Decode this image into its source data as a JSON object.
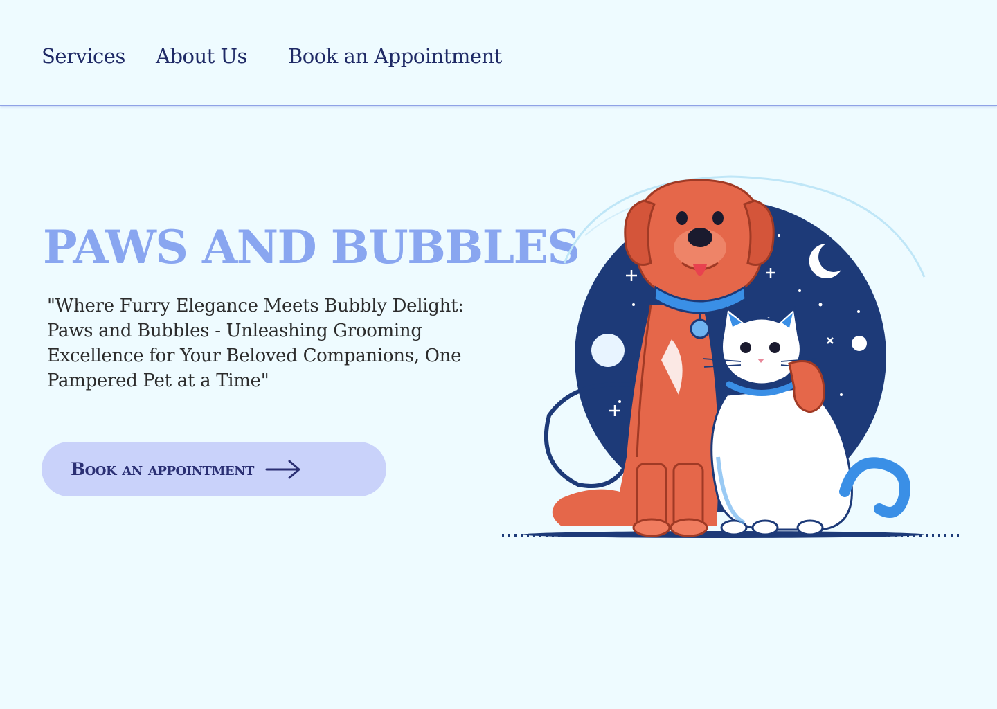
{
  "nav": {
    "items": [
      {
        "label": "Services"
      },
      {
        "label": "About Us"
      },
      {
        "label": "Book an Appointment"
      }
    ]
  },
  "hero": {
    "title": "PAWS AND BUBBLES",
    "tagline": "\"Where Furry Elegance Meets Bubbly Delight: Paws and Bubbles - Unleashing Grooming Excellence for Your Beloved Companions, One Pampered Pet at a Time\"",
    "cta_label": "Book an appointment",
    "cta_icon": "arrow-right-icon",
    "illustration": "dog-and-cat-illustration"
  },
  "colors": {
    "background": "#eefbff",
    "nav_text": "#1f2a66",
    "title": "#89a6f0",
    "cta_bg": "#c9d2fa",
    "cta_text": "#2a2f73",
    "dog": "#e5674a",
    "night": "#1d3a78",
    "cat_accent": "#3a8fe6"
  }
}
